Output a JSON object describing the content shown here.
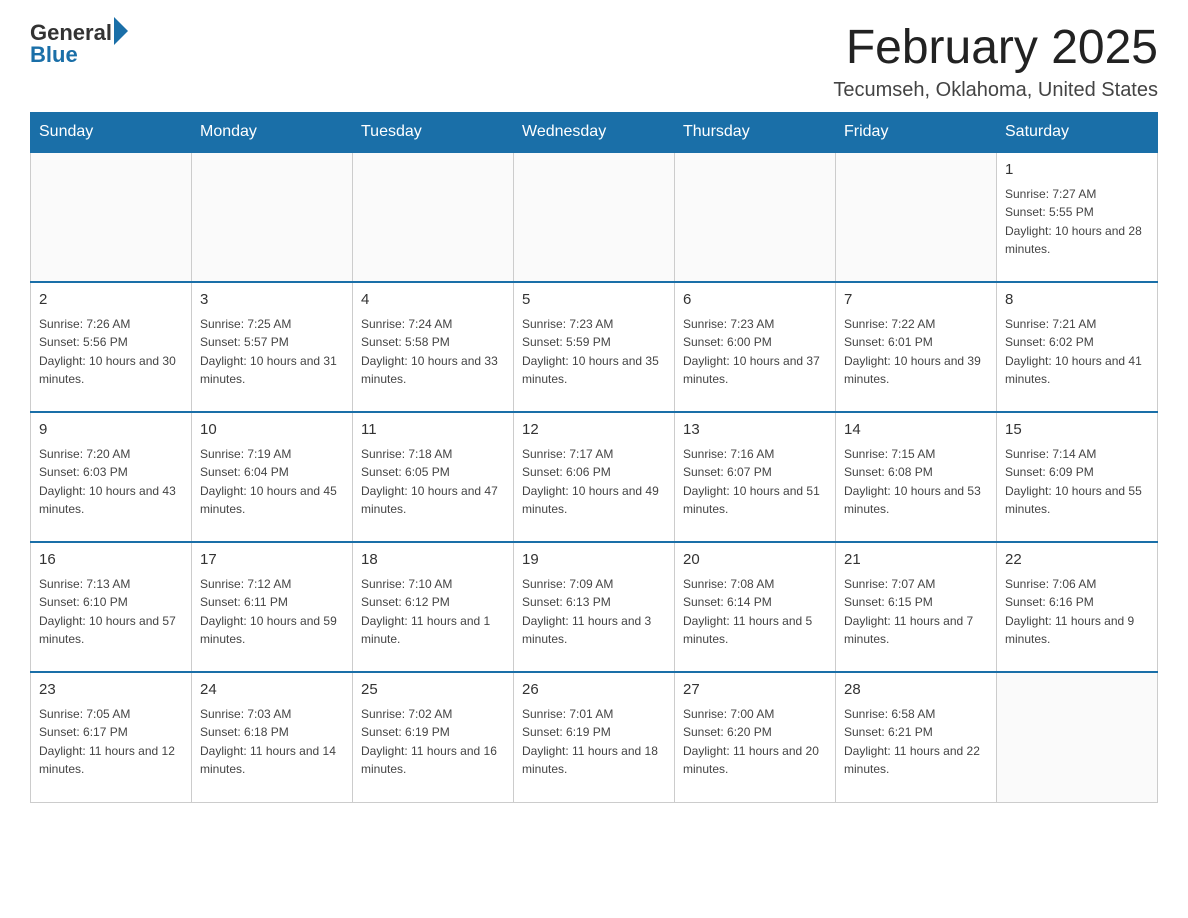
{
  "logo": {
    "general": "General",
    "blue": "Blue"
  },
  "title": "February 2025",
  "subtitle": "Tecumseh, Oklahoma, United States",
  "days_of_week": [
    "Sunday",
    "Monday",
    "Tuesday",
    "Wednesday",
    "Thursday",
    "Friday",
    "Saturday"
  ],
  "weeks": [
    [
      {
        "day": "",
        "info": ""
      },
      {
        "day": "",
        "info": ""
      },
      {
        "day": "",
        "info": ""
      },
      {
        "day": "",
        "info": ""
      },
      {
        "day": "",
        "info": ""
      },
      {
        "day": "",
        "info": ""
      },
      {
        "day": "1",
        "info": "Sunrise: 7:27 AM\nSunset: 5:55 PM\nDaylight: 10 hours and 28 minutes."
      }
    ],
    [
      {
        "day": "2",
        "info": "Sunrise: 7:26 AM\nSunset: 5:56 PM\nDaylight: 10 hours and 30 minutes."
      },
      {
        "day": "3",
        "info": "Sunrise: 7:25 AM\nSunset: 5:57 PM\nDaylight: 10 hours and 31 minutes."
      },
      {
        "day": "4",
        "info": "Sunrise: 7:24 AM\nSunset: 5:58 PM\nDaylight: 10 hours and 33 minutes."
      },
      {
        "day": "5",
        "info": "Sunrise: 7:23 AM\nSunset: 5:59 PM\nDaylight: 10 hours and 35 minutes."
      },
      {
        "day": "6",
        "info": "Sunrise: 7:23 AM\nSunset: 6:00 PM\nDaylight: 10 hours and 37 minutes."
      },
      {
        "day": "7",
        "info": "Sunrise: 7:22 AM\nSunset: 6:01 PM\nDaylight: 10 hours and 39 minutes."
      },
      {
        "day": "8",
        "info": "Sunrise: 7:21 AM\nSunset: 6:02 PM\nDaylight: 10 hours and 41 minutes."
      }
    ],
    [
      {
        "day": "9",
        "info": "Sunrise: 7:20 AM\nSunset: 6:03 PM\nDaylight: 10 hours and 43 minutes."
      },
      {
        "day": "10",
        "info": "Sunrise: 7:19 AM\nSunset: 6:04 PM\nDaylight: 10 hours and 45 minutes."
      },
      {
        "day": "11",
        "info": "Sunrise: 7:18 AM\nSunset: 6:05 PM\nDaylight: 10 hours and 47 minutes."
      },
      {
        "day": "12",
        "info": "Sunrise: 7:17 AM\nSunset: 6:06 PM\nDaylight: 10 hours and 49 minutes."
      },
      {
        "day": "13",
        "info": "Sunrise: 7:16 AM\nSunset: 6:07 PM\nDaylight: 10 hours and 51 minutes."
      },
      {
        "day": "14",
        "info": "Sunrise: 7:15 AM\nSunset: 6:08 PM\nDaylight: 10 hours and 53 minutes."
      },
      {
        "day": "15",
        "info": "Sunrise: 7:14 AM\nSunset: 6:09 PM\nDaylight: 10 hours and 55 minutes."
      }
    ],
    [
      {
        "day": "16",
        "info": "Sunrise: 7:13 AM\nSunset: 6:10 PM\nDaylight: 10 hours and 57 minutes."
      },
      {
        "day": "17",
        "info": "Sunrise: 7:12 AM\nSunset: 6:11 PM\nDaylight: 10 hours and 59 minutes."
      },
      {
        "day": "18",
        "info": "Sunrise: 7:10 AM\nSunset: 6:12 PM\nDaylight: 11 hours and 1 minute."
      },
      {
        "day": "19",
        "info": "Sunrise: 7:09 AM\nSunset: 6:13 PM\nDaylight: 11 hours and 3 minutes."
      },
      {
        "day": "20",
        "info": "Sunrise: 7:08 AM\nSunset: 6:14 PM\nDaylight: 11 hours and 5 minutes."
      },
      {
        "day": "21",
        "info": "Sunrise: 7:07 AM\nSunset: 6:15 PM\nDaylight: 11 hours and 7 minutes."
      },
      {
        "day": "22",
        "info": "Sunrise: 7:06 AM\nSunset: 6:16 PM\nDaylight: 11 hours and 9 minutes."
      }
    ],
    [
      {
        "day": "23",
        "info": "Sunrise: 7:05 AM\nSunset: 6:17 PM\nDaylight: 11 hours and 12 minutes."
      },
      {
        "day": "24",
        "info": "Sunrise: 7:03 AM\nSunset: 6:18 PM\nDaylight: 11 hours and 14 minutes."
      },
      {
        "day": "25",
        "info": "Sunrise: 7:02 AM\nSunset: 6:19 PM\nDaylight: 11 hours and 16 minutes."
      },
      {
        "day": "26",
        "info": "Sunrise: 7:01 AM\nSunset: 6:19 PM\nDaylight: 11 hours and 18 minutes."
      },
      {
        "day": "27",
        "info": "Sunrise: 7:00 AM\nSunset: 6:20 PM\nDaylight: 11 hours and 20 minutes."
      },
      {
        "day": "28",
        "info": "Sunrise: 6:58 AM\nSunset: 6:21 PM\nDaylight: 11 hours and 22 minutes."
      },
      {
        "day": "",
        "info": ""
      }
    ]
  ]
}
